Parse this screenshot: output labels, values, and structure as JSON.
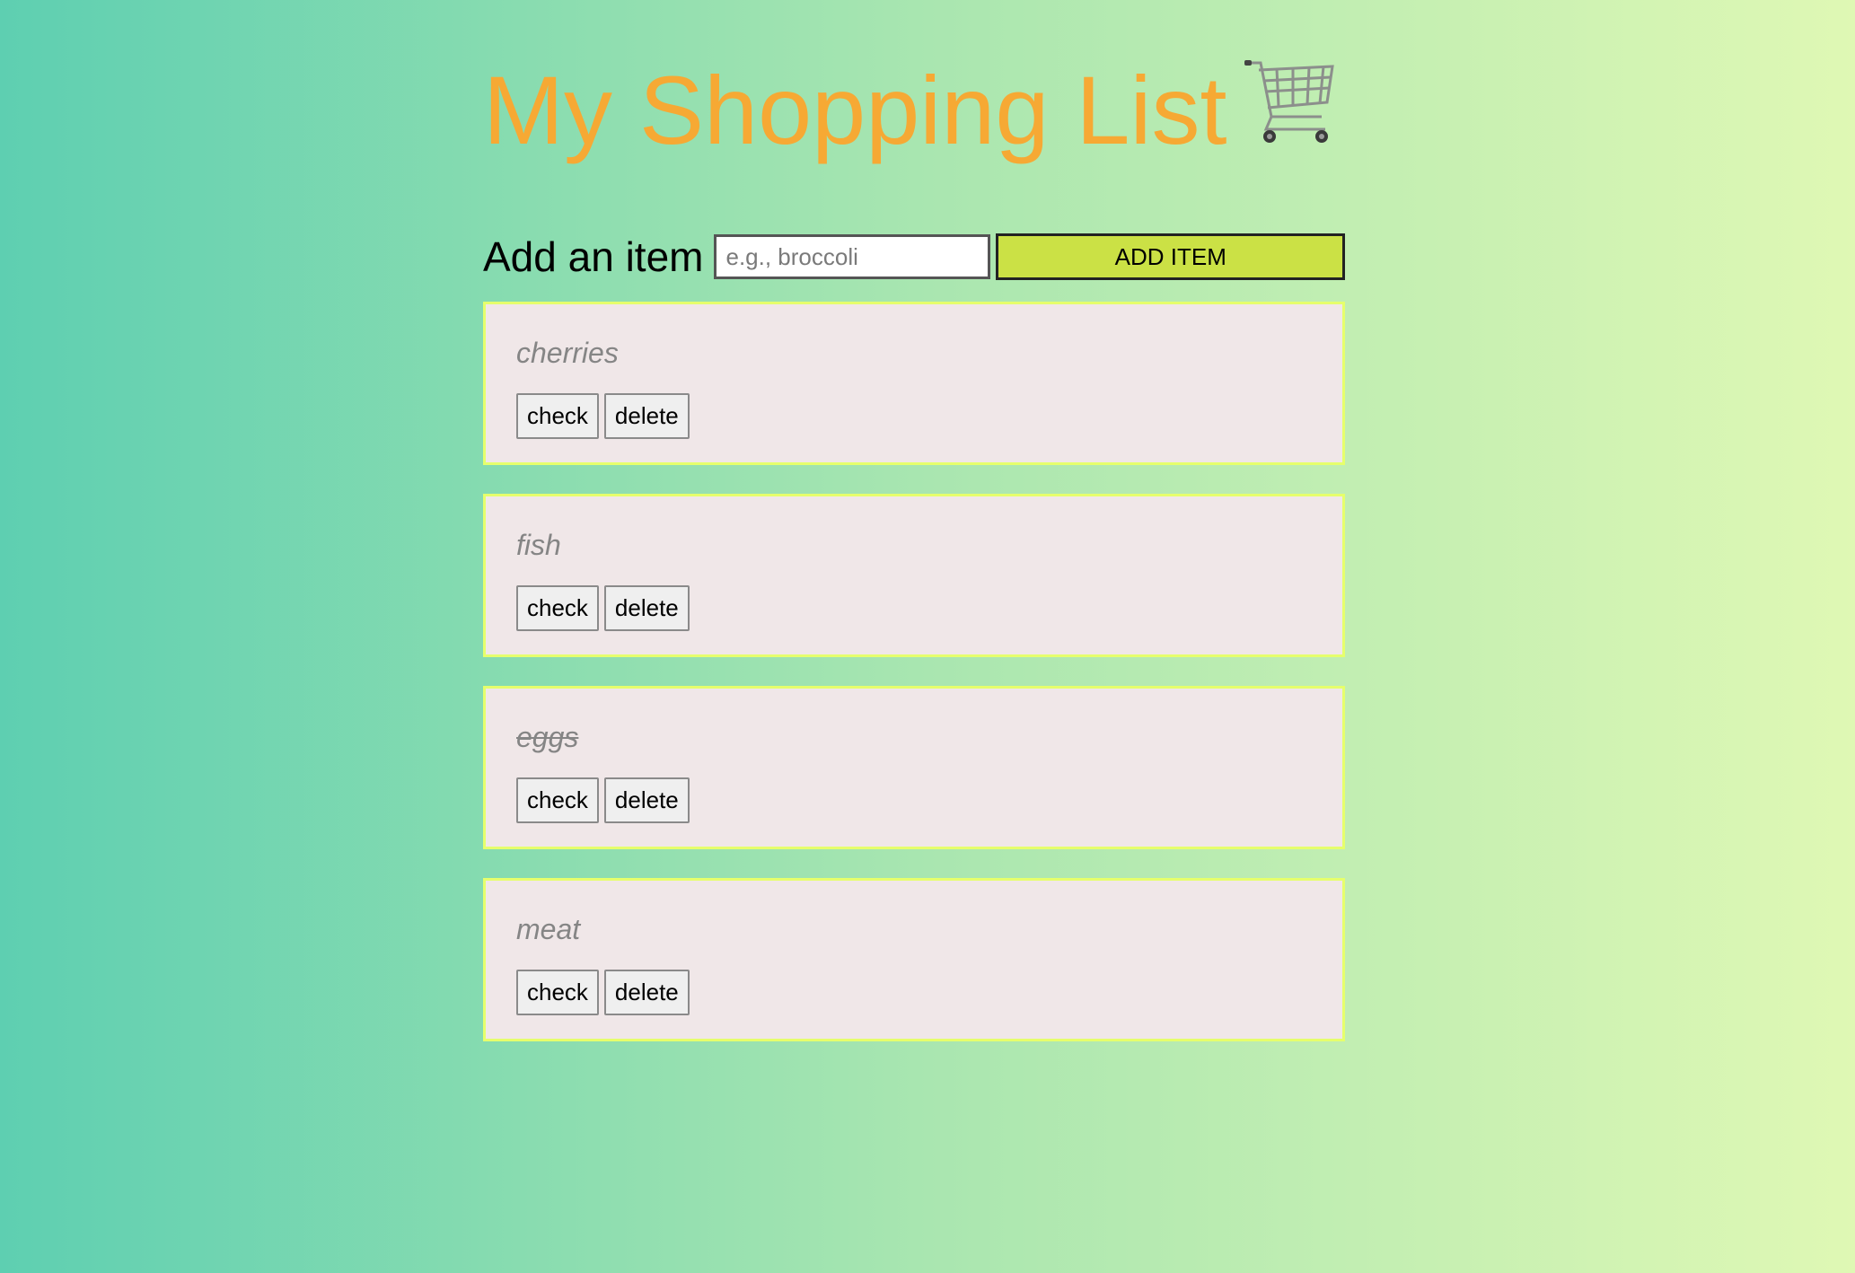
{
  "header": {
    "title": "My Shopping List"
  },
  "add_form": {
    "label": "Add an item",
    "input_value": "",
    "input_placeholder": "e.g., broccoli",
    "button_label": "ADD ITEM"
  },
  "items": [
    {
      "name": "cherries",
      "checked": false,
      "check_label": "check",
      "delete_label": "delete"
    },
    {
      "name": "fish",
      "checked": false,
      "check_label": "check",
      "delete_label": "delete"
    },
    {
      "name": "eggs",
      "checked": true,
      "check_label": "check",
      "delete_label": "delete"
    },
    {
      "name": "meat",
      "checked": false,
      "check_label": "check",
      "delete_label": "delete"
    }
  ],
  "colors": {
    "title": "#f6a934",
    "add_button": "#cbe145",
    "item_background": "#f0e7e8",
    "item_border": "#e6ff6c",
    "item_text": "#858585"
  },
  "icons": {
    "title_icon": "shopping-cart-icon"
  }
}
